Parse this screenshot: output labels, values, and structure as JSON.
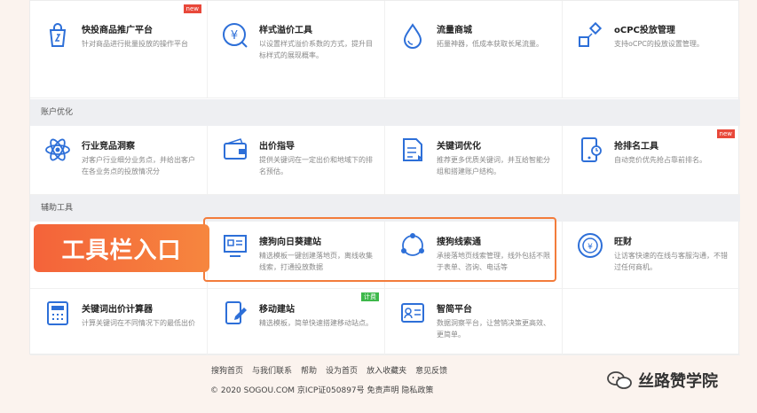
{
  "rows": [
    [
      {
        "name": "kuaitou-cell",
        "icon": "bag-icon",
        "title": "快投商品推广平台",
        "desc": "针对商品进行批量投放的操作平台",
        "badge": "new"
      },
      {
        "name": "style-bid-cell",
        "icon": "yen-icon",
        "title": "样式溢价工具",
        "desc": "以设置样式溢价系数的方式，提升目标样式的展现概率。",
        "badge": ""
      },
      {
        "name": "liuliang-cell",
        "icon": "drop-icon",
        "title": "流量商城",
        "desc": "拓量神器，低成本获取长尾流量。",
        "badge": ""
      },
      {
        "name": "ocpc-cell",
        "icon": "ocpc-icon",
        "title": "oCPC投放管理",
        "desc": "支持oCPC的投放设置管理。",
        "badge": ""
      }
    ],
    [
      {
        "name": "industry-cell",
        "icon": "atom-icon",
        "title": "行业竞品洞察",
        "desc": "对客户行业细分业务点，并给出客户在各业务点的投放情况分",
        "badge": ""
      },
      {
        "name": "bid-guide-cell",
        "icon": "wallet-icon",
        "title": "出价指导",
        "desc": "提供关键词在一定出价和地域下的排名预估。",
        "badge": ""
      },
      {
        "name": "keyword-opt-cell",
        "icon": "document-icon",
        "title": "关键词优化",
        "desc": "推荐更多优质关键词，并互给智能分组和搭建账户结构。",
        "badge": ""
      },
      {
        "name": "rank-tool-cell",
        "icon": "phone-icon",
        "title": "抢排名工具",
        "desc": "自动竞价优先抢占靠前排名。",
        "badge": "new"
      }
    ],
    [
      {
        "name": "build-site-cell",
        "icon": "monitor-icon",
        "title": "搜狗向日葵建站",
        "desc": "精选模板一键创建落地页，离线收集线索，打通投放数据",
        "badge": ""
      },
      {
        "name": "leads-cell",
        "icon": "network-icon",
        "title": "搜狗线索通",
        "desc": "承接落地页线索管理，线外包括不限于表单、咨询、电话等",
        "badge": ""
      },
      {
        "name": "wangcai-cell",
        "icon": "coin-icon",
        "title": "旺财",
        "desc": "让访客快速的在线与客服沟通，不错过任何商机。",
        "badge": ""
      }
    ],
    [
      {
        "name": "calculator-cell",
        "icon": "calculator-icon",
        "title": "关键词出价计算器",
        "desc": "计算关键词在不同情况下的最低出价",
        "badge": ""
      },
      {
        "name": "mobile-site-cell",
        "icon": "edit-icon",
        "title": "移动建站",
        "desc": "精选模板，简单快速搭建移动站点。",
        "badge": "计费"
      },
      {
        "name": "zhijian-cell",
        "icon": "idcard-icon",
        "title": "智简平台",
        "desc": "数据洞察平台，让营销决策更高效、更简单。",
        "badge": ""
      },
      {
        "name": "empty-cell",
        "icon": "",
        "title": "",
        "desc": "",
        "badge": ""
      }
    ]
  ],
  "sections": {
    "account": "账户优化",
    "aux": "辅助工具"
  },
  "banner": "工具栏入口",
  "footer": {
    "links": [
      "搜狗首页",
      "与我们联系",
      "帮助",
      "设为首页",
      "放入收藏夹",
      "意见反馈"
    ],
    "copyright": "© 2020 SOGOU.COM 京ICP证050897号 免责声明 隐私政策"
  },
  "watermark": "丝路赞学院",
  "colors": {
    "accent": "#2d6fd8",
    "highlight": "#f37c3b",
    "badge_new": "#e8483a",
    "badge_plan": "#3db84a"
  }
}
